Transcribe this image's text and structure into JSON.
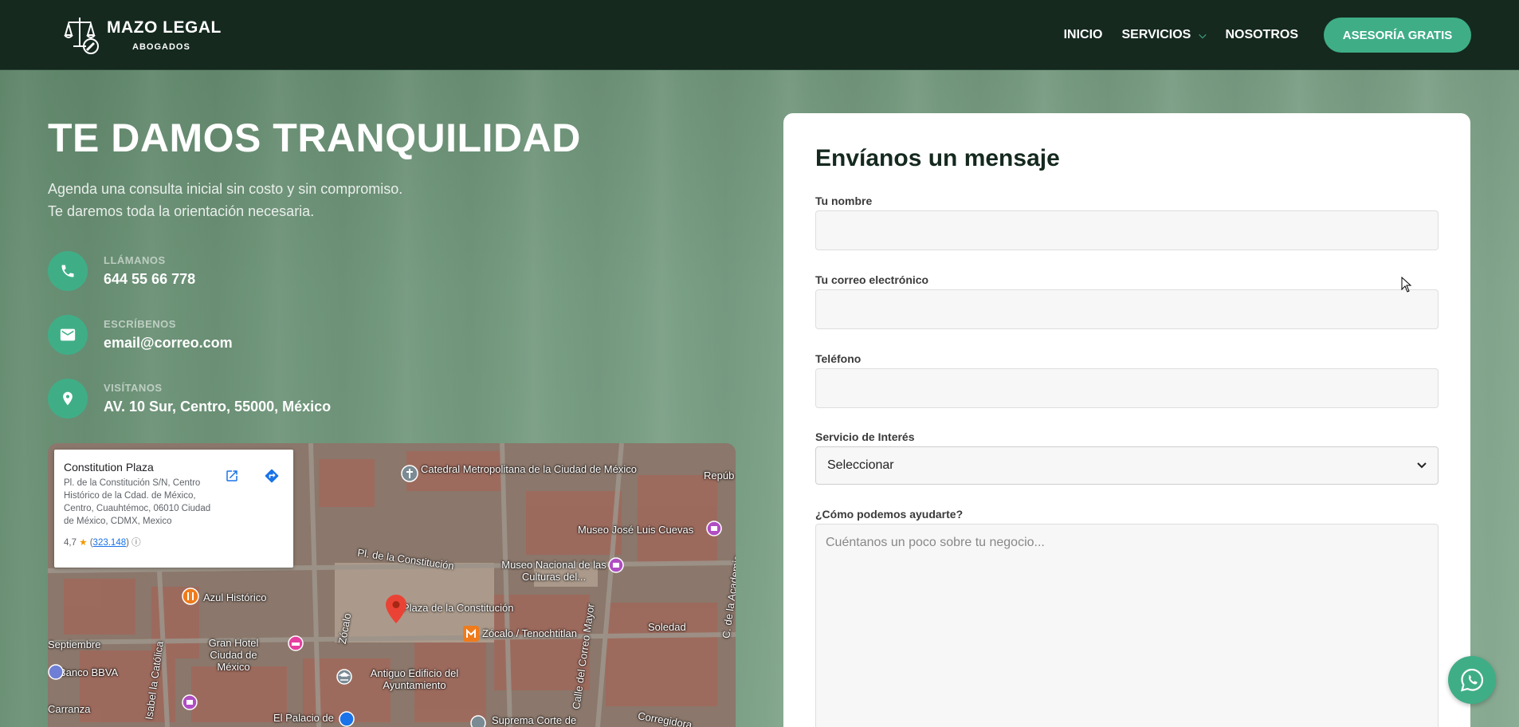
{
  "brand": {
    "name": "MAZO LEGAL",
    "tagline": "ABOGADOS"
  },
  "nav": {
    "items": [
      {
        "label": "INICIO"
      },
      {
        "label": "SERVICIOS"
      },
      {
        "label": "NOSOTROS"
      }
    ],
    "cta": "ASESORÍA GRATIS"
  },
  "hero": {
    "title": "TE DAMOS TRANQUILIDAD",
    "subtitle_line1": "Agenda una consulta inicial sin costo y sin compromiso.",
    "subtitle_line2": "Te daremos toda la orientación necesaria."
  },
  "contact": [
    {
      "label": "LLÁMANOS",
      "value": "644 55 66 778",
      "icon": "phone-icon"
    },
    {
      "label": "ESCRÍBENOS",
      "value": "email@correo.com",
      "icon": "mail-icon"
    },
    {
      "label": "VISÍTANOS",
      "value": "AV. 10 Sur, Centro, 55000, México",
      "icon": "location-pin-icon"
    }
  ],
  "map": {
    "place_name": "Constitution Plaza",
    "address": "Pl. de la Constitución S/N, Centro Histórico de la Cdad. de México, Centro, Cuauhtémoc, 06010 Ciudad de México, CDMX, Mexico",
    "rating": "4,7",
    "reviews": "323.148",
    "labels": {
      "catedral": "Catedral Metropolitana de la Ciudad de México",
      "repub": "Repúb",
      "cuevas": "Museo José Luis Cuevas",
      "pl_const": "Pl. de la Constitución",
      "culturas": "Museo Nacional de las Culturas del...",
      "azul": "Azul Histórico",
      "plaza": "Plaza de la Constitución",
      "zocalo_metro": "Zócalo / Tenochtitlan",
      "soledad": "Soledad",
      "septiembre": "Septiembre",
      "gran_hotel": "Gran Hotel Ciudad de México",
      "zocalo_st": "Zócalo",
      "banco": "Banco BBVA",
      "antiguo": "Antiguo Edificio del Ayuntamiento",
      "carranza": "Carranza",
      "palacio": "El Palacio de",
      "suprema": "Suprema Corte de",
      "catolica": "Isabel la Católica",
      "correo_mayor": "Calle del Correo Mayor",
      "academia": "C. de la Academia",
      "corregidora": "Corregidora"
    }
  },
  "form": {
    "title": "Envíanos un mensaje",
    "name_label": "Tu nombre",
    "email_label": "Tu correo electrónico",
    "phone_label": "Teléfono",
    "service_label": "Servicio de Interés",
    "service_selected": "Seleccionar",
    "message_label": "¿Cómo podemos ayudarte?",
    "message_placeholder": "Cuéntanos un poco sobre tu negocio..."
  },
  "colors": {
    "header_bg": "#15291f",
    "accent": "#3fae87",
    "form_title": "#15291f"
  }
}
